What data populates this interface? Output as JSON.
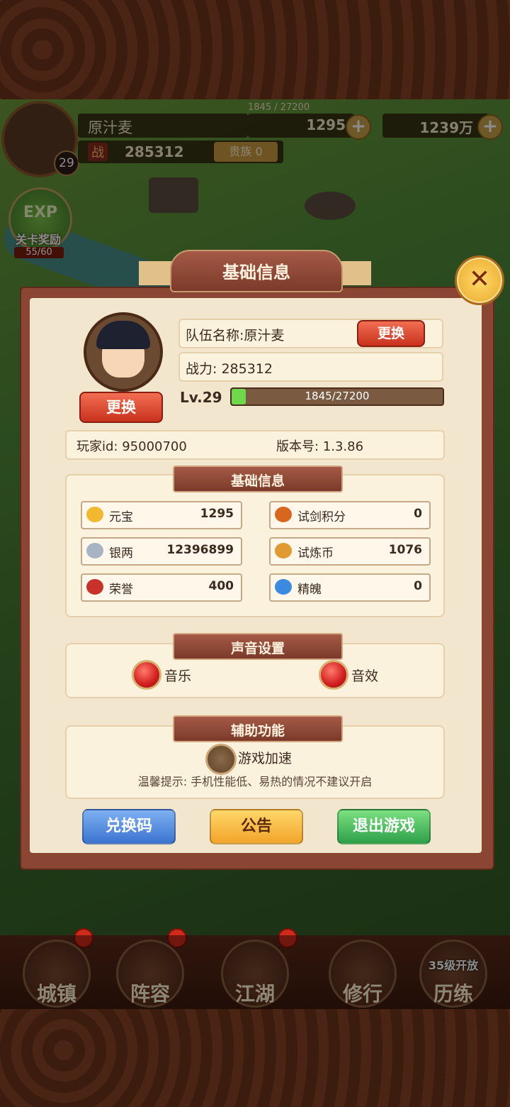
{
  "hud": {
    "player_name": "原汁麦",
    "exp_text": "1845 / 27200",
    "gold": "1295",
    "silver": "1239万",
    "power_icon": "战",
    "power": "285312",
    "noble": "贵族 0",
    "level": "29",
    "exp_orb_label": "EXP",
    "stage_reward": "关卡奖励",
    "stage_reward_count": "55/60"
  },
  "dialog": {
    "title": "基础信息",
    "change_avatar_label": "更换",
    "team_name": "队伍名称:原汁麦",
    "change_name_label": "更换",
    "power": "战力: 285312",
    "level": "Lv.29",
    "exp": "1845/27200",
    "exp_progress": 0.068,
    "player_id": "玩家id: 95000700",
    "version": "版本号: 1.3.86",
    "basic_section_title": "基础信息",
    "stats": [
      {
        "name": "元宝",
        "value": "1295",
        "icon": "gold-ingot-icon"
      },
      {
        "name": "试剑积分",
        "value": "0",
        "icon": "sword-points-icon"
      },
      {
        "name": "银两",
        "value": "12396899",
        "icon": "silver-ingot-icon"
      },
      {
        "name": "试炼币",
        "value": "1076",
        "icon": "trial-coin-icon"
      },
      {
        "name": "荣誉",
        "value": "400",
        "icon": "honor-icon"
      },
      {
        "name": "精魄",
        "value": "0",
        "icon": "spirit-icon"
      }
    ],
    "sound_section_title": "声音设置",
    "music_label": "音乐",
    "sfx_label": "音效",
    "assist_section_title": "辅助功能",
    "speed_label": "游戏加速",
    "tip": "温馨提示: 手机性能低、易热的情况不建议开启",
    "redeem_label": "兑换码",
    "notice_label": "公告",
    "exit_label": "退出游戏"
  },
  "nav": [
    {
      "label": "城镇"
    },
    {
      "label": "阵容"
    },
    {
      "label": "江湖"
    },
    {
      "label": "修行"
    },
    {
      "label": "历练",
      "lock": "35级开放"
    }
  ],
  "colors": {
    "dialog_bg": "#f3e6cf",
    "frame": "#8a4632",
    "title_plate": "#7c3a2a",
    "exp_fill": "#6ed84a"
  }
}
